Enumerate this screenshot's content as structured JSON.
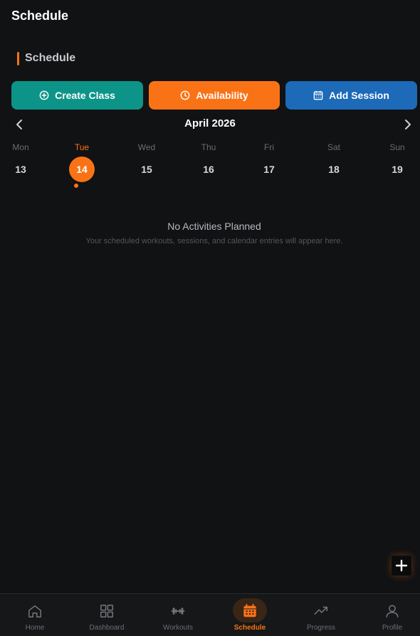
{
  "header": {
    "title": "Schedule"
  },
  "section": {
    "title": "Schedule"
  },
  "actions": {
    "create_class": "Create Class",
    "availability": "Availability",
    "add_session": "Add Session"
  },
  "calendar": {
    "month_label": "April 2026",
    "days": [
      {
        "name": "Mon",
        "num": "13"
      },
      {
        "name": "Tue",
        "num": "14"
      },
      {
        "name": "Wed",
        "num": "15"
      },
      {
        "name": "Thu",
        "num": "16"
      },
      {
        "name": "Fri",
        "num": "17"
      },
      {
        "name": "Sat",
        "num": "18"
      },
      {
        "name": "Sun",
        "num": "19"
      }
    ]
  },
  "empty_state": {
    "title": "No Activities Planned",
    "subtitle": "Your scheduled workouts, sessions, and calendar entries will appear here."
  },
  "bottom_nav": {
    "items": [
      {
        "label": "Home",
        "icon": "home-icon"
      },
      {
        "label": "Dashboard",
        "icon": "grid-icon"
      },
      {
        "label": "Workouts",
        "icon": "dumbbell-icon"
      },
      {
        "label": "Schedule",
        "icon": "calendar-icon"
      },
      {
        "label": "Progress",
        "icon": "trend-up-icon"
      },
      {
        "label": "Profile",
        "icon": "user-icon"
      }
    ]
  },
  "colors": {
    "background": "#111214",
    "accent": "#f97316",
    "teal": "#0d9488",
    "blue": "#1c6ab8"
  }
}
